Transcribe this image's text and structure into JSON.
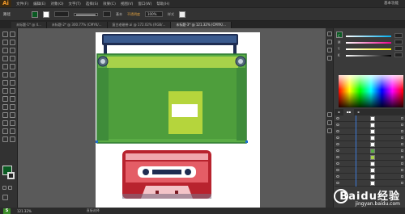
{
  "app": {
    "logo": "Ai"
  },
  "menubar": {
    "items": [
      "文件(F)",
      "编辑(E)",
      "对象(O)",
      "文字(T)",
      "选择(S)",
      "效果(C)",
      "视图(V)",
      "窗口(W)",
      "帮助(H)"
    ],
    "workspace": "基本功能"
  },
  "control": {
    "label": "路径",
    "fill_color": "#0a5a22",
    "stroke_color": "#ffffff",
    "brush": "基本",
    "opacity_label": "不透明度",
    "opacity_value": "100%",
    "style_label": "样式"
  },
  "tabs": [
    {
      "label": "未标题-1* @ 4...",
      "active": false
    },
    {
      "label": "未标题-2* @ 300.77% (CMYK/...",
      "active": false
    },
    {
      "label": "复古老磁带.ai @ 172.02% (RGB/...",
      "active": false
    },
    {
      "label": "未标题-3* @ 121.32% (CMYK/...",
      "active": true
    }
  ],
  "status": {
    "logo": "S",
    "zoom": "121.32%",
    "text": "直接选择"
  },
  "colors": {
    "accent_green": "#6cb33f",
    "dark_green": "#2f8f3a",
    "navy": "#2a3e6e",
    "cassette_red": "#d9363c"
  },
  "watermark": {
    "main": "Baidu经验",
    "sub": "jingyan.baidu.com"
  }
}
